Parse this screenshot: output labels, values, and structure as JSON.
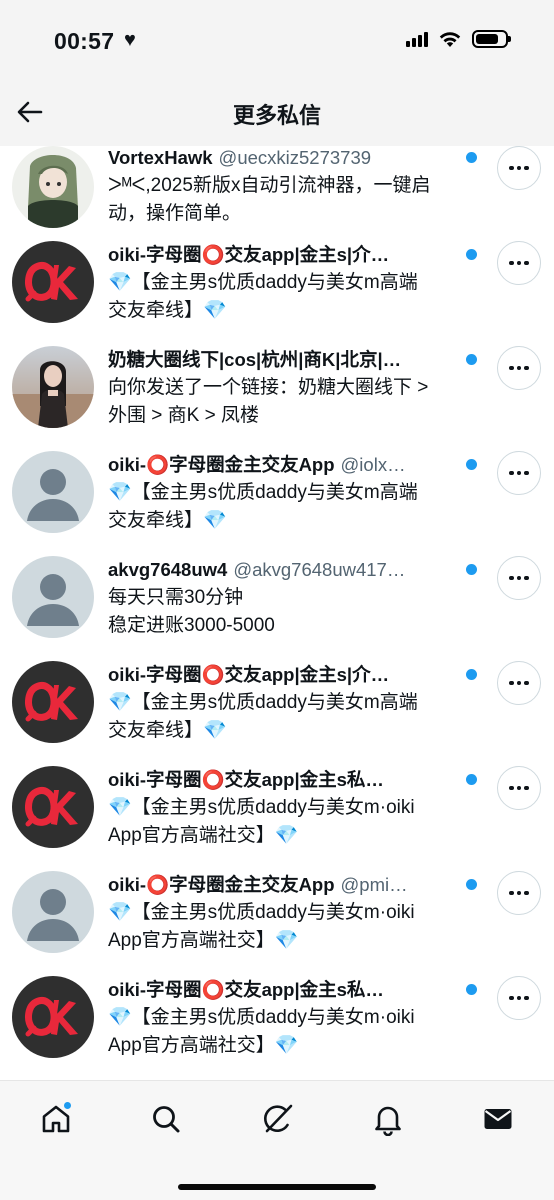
{
  "status_bar": {
    "time": "00:57",
    "heart": "♥",
    "battery_level": 0.8
  },
  "header": {
    "title": "更多私信",
    "back_icon": "arrow-left-icon"
  },
  "conversations": [
    {
      "name": "VortexHawk",
      "handle": "@uecxkiz5273739",
      "preview": "ᐳᴹᐸ,2025新版x自动引流神器，一键启\n动，操作简单。",
      "avatar": "anime-girl",
      "unread": true
    },
    {
      "name": "oiki-字母圈⭕交友app|金主s|介…",
      "handle": "",
      "preview": "💎【金主男s优质daddy与美女m高端\n交友牵线】💎",
      "avatar": "ok-logo",
      "unread": true
    },
    {
      "name": "奶糖大圈线下|cos|杭州|商K|北京|…",
      "handle": "",
      "preview": "向你发送了一个链接：奶糖大圈线下 >\n外围 > 商K > 凤楼",
      "avatar": "photo-woman",
      "unread": true
    },
    {
      "name": "oiki-⭕字母圈金主交友App",
      "handle": "@iolx…",
      "preview": "💎【金主男s优质daddy与美女m高端\n交友牵线】💎",
      "avatar": "default",
      "unread": true
    },
    {
      "name": "akvg7648uw4",
      "handle": "@akvg7648uw417…",
      "preview": "每天只需30分钟\n稳定进账3000-5000",
      "avatar": "default",
      "unread": true
    },
    {
      "name": "oiki-字母圈⭕交友app|金主s|介…",
      "handle": "",
      "preview": "💎【金主男s优质daddy与美女m高端\n交友牵线】💎",
      "avatar": "ok-logo",
      "unread": true
    },
    {
      "name": "oiki-字母圈⭕交友app|金主s私…",
      "handle": "",
      "preview": "💎【金主男s优质daddy与美女m·oiki\nApp官方高端社交】💎",
      "avatar": "ok-logo",
      "unread": true
    },
    {
      "name": "oiki-⭕字母圈金主交友App",
      "handle": "@pmi…",
      "preview": "💎【金主男s优质daddy与美女m·oiki\nApp官方高端社交】💎",
      "avatar": "default",
      "unread": true
    },
    {
      "name": "oiki-字母圈⭕交友app|金主s私…",
      "handle": "",
      "preview": "💎【金主男s优质daddy与美女m·oiki\nApp官方高端社交】💎",
      "avatar": "ok-logo",
      "unread": true
    }
  ],
  "tabbar": {
    "items": [
      "home-icon",
      "search-icon",
      "grok-icon",
      "notifications-bell-icon",
      "messages-envelope-icon"
    ],
    "active": "messages-envelope-icon"
  },
  "colors": {
    "accent": "#1d9bf0",
    "text": "#0f1419",
    "secondary": "#536471",
    "ok_red": "#e8283b"
  }
}
